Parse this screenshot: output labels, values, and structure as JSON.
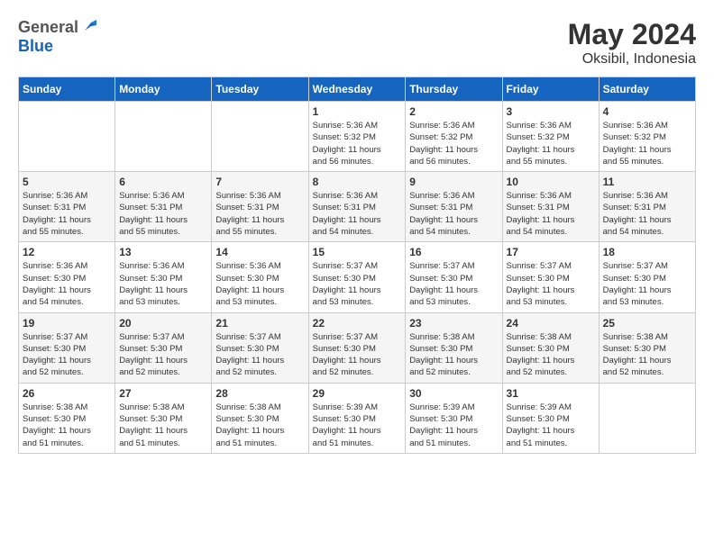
{
  "header": {
    "logo_general": "General",
    "logo_blue": "Blue",
    "month": "May 2024",
    "location": "Oksibil, Indonesia"
  },
  "days_of_week": [
    "Sunday",
    "Monday",
    "Tuesday",
    "Wednesday",
    "Thursday",
    "Friday",
    "Saturday"
  ],
  "weeks": [
    [
      {
        "day": "",
        "info": ""
      },
      {
        "day": "",
        "info": ""
      },
      {
        "day": "",
        "info": ""
      },
      {
        "day": "1",
        "info": "Sunrise: 5:36 AM\nSunset: 5:32 PM\nDaylight: 11 hours\nand 56 minutes."
      },
      {
        "day": "2",
        "info": "Sunrise: 5:36 AM\nSunset: 5:32 PM\nDaylight: 11 hours\nand 56 minutes."
      },
      {
        "day": "3",
        "info": "Sunrise: 5:36 AM\nSunset: 5:32 PM\nDaylight: 11 hours\nand 55 minutes."
      },
      {
        "day": "4",
        "info": "Sunrise: 5:36 AM\nSunset: 5:32 PM\nDaylight: 11 hours\nand 55 minutes."
      }
    ],
    [
      {
        "day": "5",
        "info": "Sunrise: 5:36 AM\nSunset: 5:31 PM\nDaylight: 11 hours\nand 55 minutes."
      },
      {
        "day": "6",
        "info": "Sunrise: 5:36 AM\nSunset: 5:31 PM\nDaylight: 11 hours\nand 55 minutes."
      },
      {
        "day": "7",
        "info": "Sunrise: 5:36 AM\nSunset: 5:31 PM\nDaylight: 11 hours\nand 55 minutes."
      },
      {
        "day": "8",
        "info": "Sunrise: 5:36 AM\nSunset: 5:31 PM\nDaylight: 11 hours\nand 54 minutes."
      },
      {
        "day": "9",
        "info": "Sunrise: 5:36 AM\nSunset: 5:31 PM\nDaylight: 11 hours\nand 54 minutes."
      },
      {
        "day": "10",
        "info": "Sunrise: 5:36 AM\nSunset: 5:31 PM\nDaylight: 11 hours\nand 54 minutes."
      },
      {
        "day": "11",
        "info": "Sunrise: 5:36 AM\nSunset: 5:31 PM\nDaylight: 11 hours\nand 54 minutes."
      }
    ],
    [
      {
        "day": "12",
        "info": "Sunrise: 5:36 AM\nSunset: 5:30 PM\nDaylight: 11 hours\nand 54 minutes."
      },
      {
        "day": "13",
        "info": "Sunrise: 5:36 AM\nSunset: 5:30 PM\nDaylight: 11 hours\nand 53 minutes."
      },
      {
        "day": "14",
        "info": "Sunrise: 5:36 AM\nSunset: 5:30 PM\nDaylight: 11 hours\nand 53 minutes."
      },
      {
        "day": "15",
        "info": "Sunrise: 5:37 AM\nSunset: 5:30 PM\nDaylight: 11 hours\nand 53 minutes."
      },
      {
        "day": "16",
        "info": "Sunrise: 5:37 AM\nSunset: 5:30 PM\nDaylight: 11 hours\nand 53 minutes."
      },
      {
        "day": "17",
        "info": "Sunrise: 5:37 AM\nSunset: 5:30 PM\nDaylight: 11 hours\nand 53 minutes."
      },
      {
        "day": "18",
        "info": "Sunrise: 5:37 AM\nSunset: 5:30 PM\nDaylight: 11 hours\nand 53 minutes."
      }
    ],
    [
      {
        "day": "19",
        "info": "Sunrise: 5:37 AM\nSunset: 5:30 PM\nDaylight: 11 hours\nand 52 minutes."
      },
      {
        "day": "20",
        "info": "Sunrise: 5:37 AM\nSunset: 5:30 PM\nDaylight: 11 hours\nand 52 minutes."
      },
      {
        "day": "21",
        "info": "Sunrise: 5:37 AM\nSunset: 5:30 PM\nDaylight: 11 hours\nand 52 minutes."
      },
      {
        "day": "22",
        "info": "Sunrise: 5:37 AM\nSunset: 5:30 PM\nDaylight: 11 hours\nand 52 minutes."
      },
      {
        "day": "23",
        "info": "Sunrise: 5:38 AM\nSunset: 5:30 PM\nDaylight: 11 hours\nand 52 minutes."
      },
      {
        "day": "24",
        "info": "Sunrise: 5:38 AM\nSunset: 5:30 PM\nDaylight: 11 hours\nand 52 minutes."
      },
      {
        "day": "25",
        "info": "Sunrise: 5:38 AM\nSunset: 5:30 PM\nDaylight: 11 hours\nand 52 minutes."
      }
    ],
    [
      {
        "day": "26",
        "info": "Sunrise: 5:38 AM\nSunset: 5:30 PM\nDaylight: 11 hours\nand 51 minutes."
      },
      {
        "day": "27",
        "info": "Sunrise: 5:38 AM\nSunset: 5:30 PM\nDaylight: 11 hours\nand 51 minutes."
      },
      {
        "day": "28",
        "info": "Sunrise: 5:38 AM\nSunset: 5:30 PM\nDaylight: 11 hours\nand 51 minutes."
      },
      {
        "day": "29",
        "info": "Sunrise: 5:39 AM\nSunset: 5:30 PM\nDaylight: 11 hours\nand 51 minutes."
      },
      {
        "day": "30",
        "info": "Sunrise: 5:39 AM\nSunset: 5:30 PM\nDaylight: 11 hours\nand 51 minutes."
      },
      {
        "day": "31",
        "info": "Sunrise: 5:39 AM\nSunset: 5:30 PM\nDaylight: 11 hours\nand 51 minutes."
      },
      {
        "day": "",
        "info": ""
      }
    ]
  ]
}
